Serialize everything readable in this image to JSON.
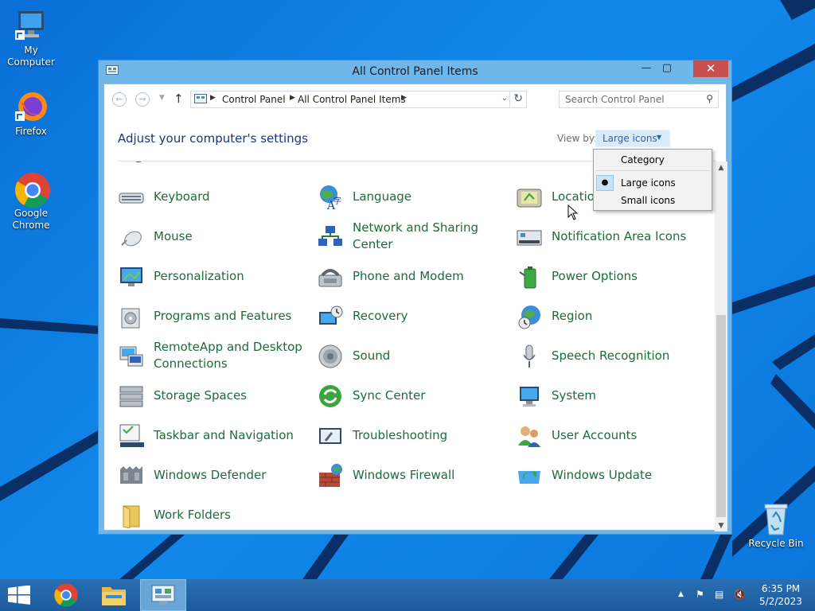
{
  "desktop": {
    "icons": [
      {
        "label": "My Computer"
      },
      {
        "label": "Firefox"
      },
      {
        "label": "Google Chrome"
      },
      {
        "label": "Recycle Bin"
      }
    ]
  },
  "window": {
    "title": "All Control Panel Items",
    "close_glyph": "✕",
    "min_glyph": "—",
    "max_glyph": "▢"
  },
  "navbar": {
    "breadcrumbs": [
      "Control Panel",
      "All Control Panel Items"
    ],
    "search_placeholder": "Search Control Panel"
  },
  "heading": "Adjust your computer's settings",
  "view_by": {
    "label": "View by:",
    "selected": "Large icons",
    "options": [
      "Category",
      "Large icons",
      "Small icons"
    ]
  },
  "items": [
    {
      "label": "Keyboard",
      "icon": "keyboard-icon"
    },
    {
      "label": "Language",
      "icon": "language-icon"
    },
    {
      "label": "Location Settings",
      "visible_label": "Location",
      "icon": "location-icon"
    },
    {
      "label": "Mouse",
      "icon": "mouse-icon"
    },
    {
      "label": "Network and Sharing Center",
      "icon": "network-icon"
    },
    {
      "label": "Notification Area Icons",
      "icon": "notification-icon"
    },
    {
      "label": "Personalization",
      "icon": "personalization-icon"
    },
    {
      "label": "Phone and Modem",
      "icon": "phone-icon"
    },
    {
      "label": "Power Options",
      "icon": "power-icon"
    },
    {
      "label": "Programs and Features",
      "icon": "programs-icon"
    },
    {
      "label": "Recovery",
      "icon": "recovery-icon"
    },
    {
      "label": "Region",
      "icon": "region-icon"
    },
    {
      "label": "RemoteApp and Desktop Connections",
      "icon": "remoteapp-icon"
    },
    {
      "label": "Sound",
      "icon": "sound-icon"
    },
    {
      "label": "Speech Recognition",
      "icon": "microphone-icon"
    },
    {
      "label": "Storage Spaces",
      "icon": "storage-icon"
    },
    {
      "label": "Sync Center",
      "icon": "sync-icon"
    },
    {
      "label": "System",
      "icon": "system-icon"
    },
    {
      "label": "Taskbar and Navigation",
      "icon": "taskbar-icon"
    },
    {
      "label": "Troubleshooting",
      "icon": "troubleshooting-icon"
    },
    {
      "label": "User Accounts",
      "icon": "users-icon"
    },
    {
      "label": "Windows Defender",
      "icon": "defender-icon"
    },
    {
      "label": "Windows Firewall",
      "icon": "firewall-icon"
    },
    {
      "label": "Windows Update",
      "icon": "update-icon"
    },
    {
      "label": "Work Folders",
      "icon": "folder-icon"
    }
  ],
  "taskbar": {
    "time": "6:35 PM",
    "date": "5/2/2023"
  },
  "colors": {
    "accent": "#1e3287",
    "link_green": "#1e6b3b",
    "close_red": "#c7504f"
  }
}
